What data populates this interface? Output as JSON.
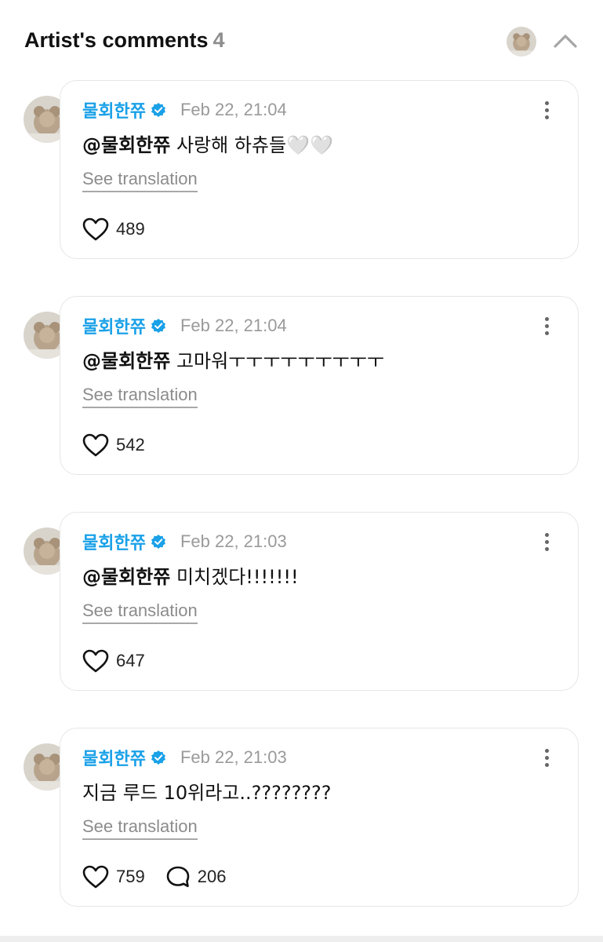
{
  "header": {
    "title": "Artist's comments",
    "count": "4",
    "collapse_icon": "chevron-up-icon"
  },
  "colors": {
    "author": "#1aa1e8",
    "verified": "#1aa1e8",
    "muted": "#9a9a9a"
  },
  "comments": [
    {
      "author": "물회한쮸",
      "date": "Feb 22, 21:04",
      "mention": "@물회한쮸",
      "text": " 사랑해 하츄들🤍🤍",
      "translate_label": "See translation",
      "likes": "489",
      "replies": ""
    },
    {
      "author": "물회한쮸",
      "date": "Feb 22, 21:04",
      "mention": "@물회한쮸",
      "text": " 고마워ㅜㅜㅜㅜㅜㅜㅜㅜㅜ",
      "translate_label": "See translation",
      "likes": "542",
      "replies": ""
    },
    {
      "author": "물회한쮸",
      "date": "Feb 22, 21:03",
      "mention": "@물회한쮸",
      "text": " 미치겠다!!!!!!!",
      "translate_label": "See translation",
      "likes": "647",
      "replies": ""
    },
    {
      "author": "물회한쮸",
      "date": "Feb 22, 21:03",
      "mention": "",
      "text": "지금 루드 10위라고..????????",
      "translate_label": "See translation",
      "likes": "759",
      "replies": "206"
    }
  ]
}
